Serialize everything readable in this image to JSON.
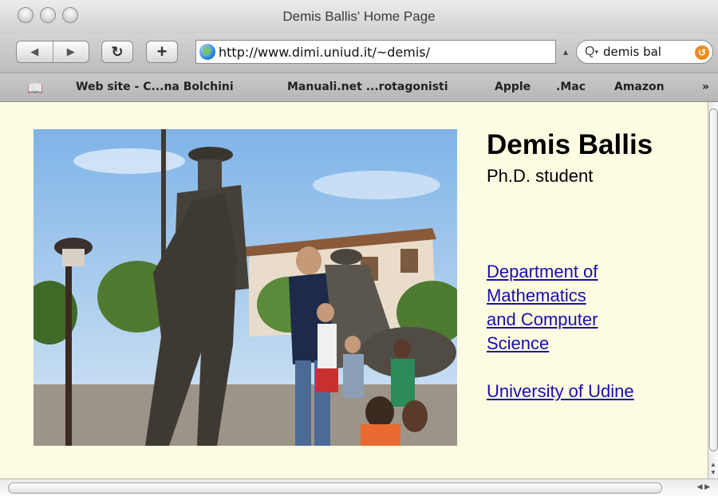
{
  "window": {
    "title": "Demis Ballis' Home Page"
  },
  "toolbar": {
    "back_icon": "back-arrow-icon",
    "forward_icon": "forward-arrow-icon",
    "reload_glyph": "↻",
    "add_bookmark_glyph": "+",
    "url": "http://www.dimi.uniud.it/~demis/",
    "search_value": "demis bal"
  },
  "bookmarks": {
    "items": [
      {
        "label": "Web site - C...na Bolchini"
      },
      {
        "label": "Manuali.net ...rotagonisti"
      },
      {
        "label": "Apple"
      },
      {
        "label": ".Mac"
      },
      {
        "label": "Amazon"
      }
    ],
    "overflow": "»"
  },
  "page": {
    "name": "Demis Ballis",
    "role": "Ph.D. student",
    "department_line1": "Department of",
    "department_line2": "Mathematics",
    "department_line3": "and Computer",
    "department_line4": "Science",
    "university": "University of Udine"
  },
  "colors": {
    "page_background": "#fdfbe2",
    "link": "#1a0dab"
  }
}
